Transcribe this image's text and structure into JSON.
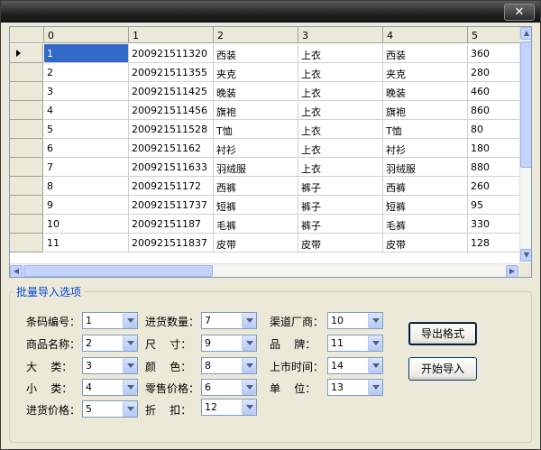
{
  "window": {
    "close_glyph": "✕"
  },
  "grid": {
    "columns": [
      "0",
      "1",
      "2",
      "3",
      "4",
      "5"
    ],
    "rows": [
      [
        "1",
        "200921511320",
        "西装",
        "上衣",
        "西装",
        "360"
      ],
      [
        "2",
        "200921511355",
        "夹克",
        "上衣",
        "夹克",
        "280"
      ],
      [
        "3",
        "200921511425",
        "晚装",
        "上衣",
        "晚装",
        "460"
      ],
      [
        "4",
        "200921511456",
        "旗袍",
        "上衣",
        "旗袍",
        "860"
      ],
      [
        "5",
        "200921511528",
        "T恤",
        "上衣",
        "T恤",
        "80"
      ],
      [
        "6",
        "20092151162",
        "衬衫",
        "上衣",
        "衬衫",
        "180"
      ],
      [
        "7",
        "200921511633",
        "羽绒服",
        "上衣",
        "羽绒服",
        "880"
      ],
      [
        "8",
        "20092151172",
        "西裤",
        "裤子",
        "西裤",
        "260"
      ],
      [
        "9",
        "200921511737",
        "短裤",
        "裤子",
        "短裤",
        "95"
      ],
      [
        "10",
        "20092151187",
        "毛裤",
        "裤子",
        "毛裤",
        "330"
      ],
      [
        "11",
        "200921511837",
        "皮带",
        "皮带",
        "皮带",
        "128"
      ]
    ],
    "selected_row": 0
  },
  "options": {
    "title": "批量导入选项",
    "fields": [
      {
        "label": "条码编号：",
        "value": "1"
      },
      {
        "label": "商品名称：",
        "value": "2"
      },
      {
        "label": "大    类：",
        "value": "3"
      },
      {
        "label": "小    类：",
        "value": "4"
      },
      {
        "label": "进货价格：",
        "value": "5"
      },
      {
        "label": "进货数量：",
        "value": "7"
      },
      {
        "label": "尺    寸：",
        "value": "9"
      },
      {
        "label": "颜    色：",
        "value": "8"
      },
      {
        "label": "零售价格：",
        "value": "6"
      },
      {
        "label": "折    扣：",
        "value": "12"
      },
      {
        "label": "渠道厂商：",
        "value": "10"
      },
      {
        "label": "品    牌：",
        "value": "11"
      },
      {
        "label": "上市时间：",
        "value": "14"
      },
      {
        "label": "单    位：",
        "value": "13"
      }
    ],
    "export_button": "导出格式",
    "import_button": "开始导入"
  }
}
